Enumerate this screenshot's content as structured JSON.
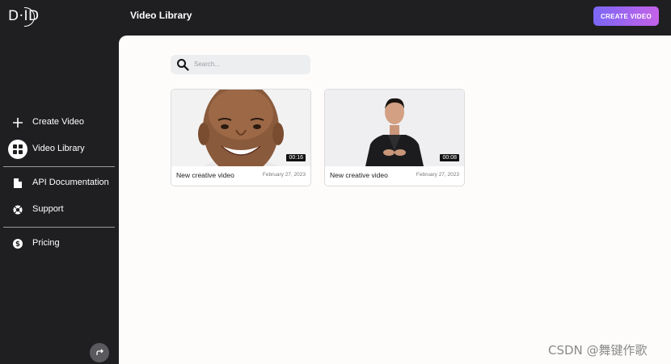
{
  "brand": {
    "logo_text": "D·ID"
  },
  "header": {
    "title": "Video Library",
    "create_button": "CREATE VIDEO"
  },
  "sidebar": {
    "items": [
      {
        "label": "Create Video",
        "icon": "plus-icon"
      },
      {
        "label": "Video Library",
        "icon": "grid-icon",
        "active": true
      },
      {
        "label": "API Documentation",
        "icon": "document-icon"
      },
      {
        "label": "Support",
        "icon": "lifebuoy-icon"
      },
      {
        "label": "Pricing",
        "icon": "dollar-icon"
      }
    ],
    "collapse_icon": "swap-arrow-icon"
  },
  "search": {
    "placeholder": "Search..."
  },
  "videos": [
    {
      "title": "New creative video",
      "date": "February 27, 2023",
      "duration": "00:16"
    },
    {
      "title": "New creative video",
      "date": "February 27, 2023",
      "duration": "00:08"
    }
  ],
  "watermark": "CSDN @舞键作歌",
  "colors": {
    "sidebar_bg": "#1f1f21",
    "main_bg": "#fdfcfb",
    "accent_start": "#7b67f5",
    "accent_end": "#c561e9"
  }
}
